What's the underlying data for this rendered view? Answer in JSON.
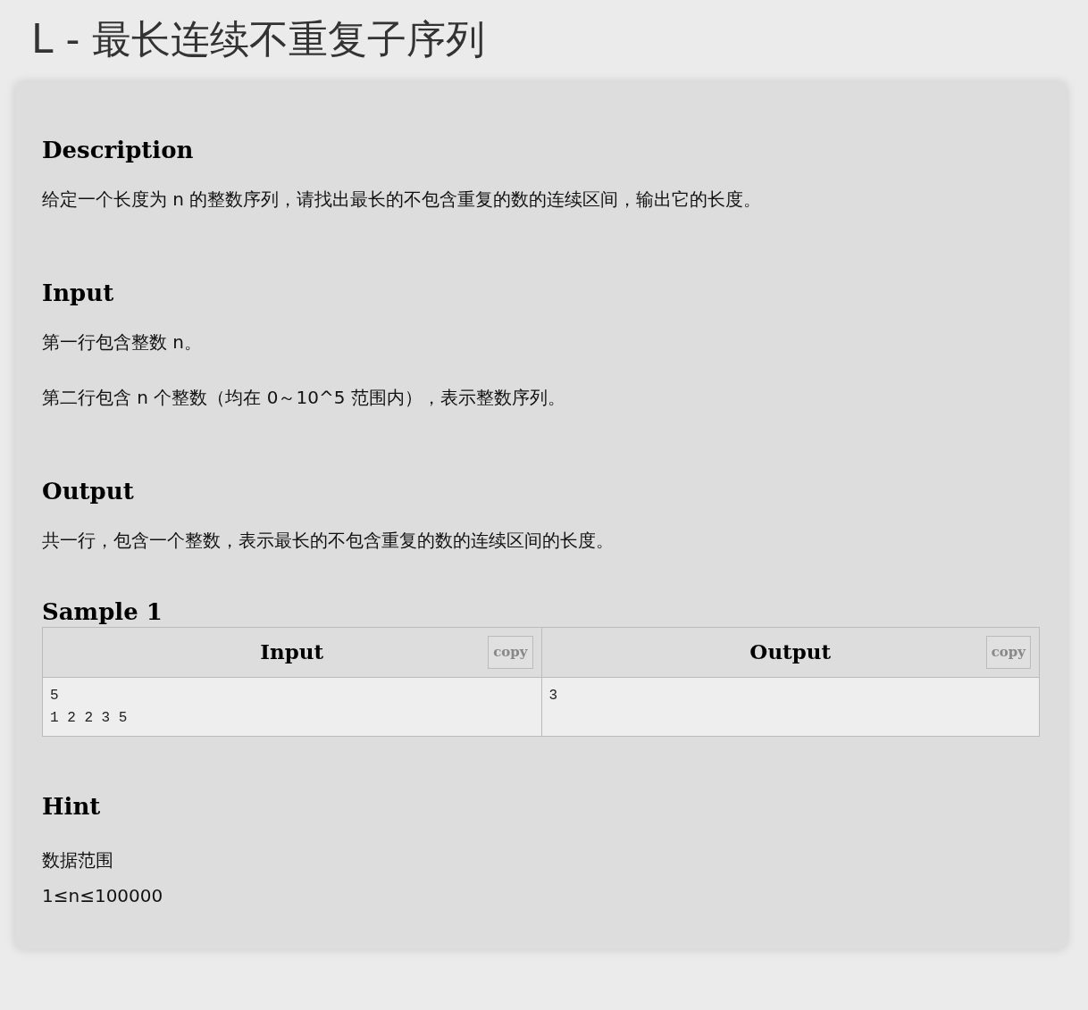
{
  "title": "L - 最长连续不重复子序列",
  "sections": [
    {
      "heading": "Description",
      "paragraphs": [
        "给定一个长度为 n 的整数序列，请找出最长的不包含重复的数的连续区间，输出它的长度。"
      ]
    },
    {
      "heading": "Input",
      "paragraphs": [
        "第一行包含整数 n。",
        "第二行包含 n 个整数（均在 0～10^5 范围内），表示整数序列。"
      ]
    },
    {
      "heading": "Output",
      "paragraphs": [
        "共一行，包含一个整数，表示最长的不包含重复的数的连续区间的长度。"
      ]
    }
  ],
  "sample": {
    "heading": "Sample 1",
    "columns": [
      {
        "label": "Input",
        "button": "copy",
        "content": "5\n1 2 2 3 5"
      },
      {
        "label": "Output",
        "button": "copy",
        "content": "3"
      }
    ]
  },
  "hint": {
    "heading": "Hint",
    "lines": [
      "数据范围",
      "1≤n≤100000"
    ]
  }
}
